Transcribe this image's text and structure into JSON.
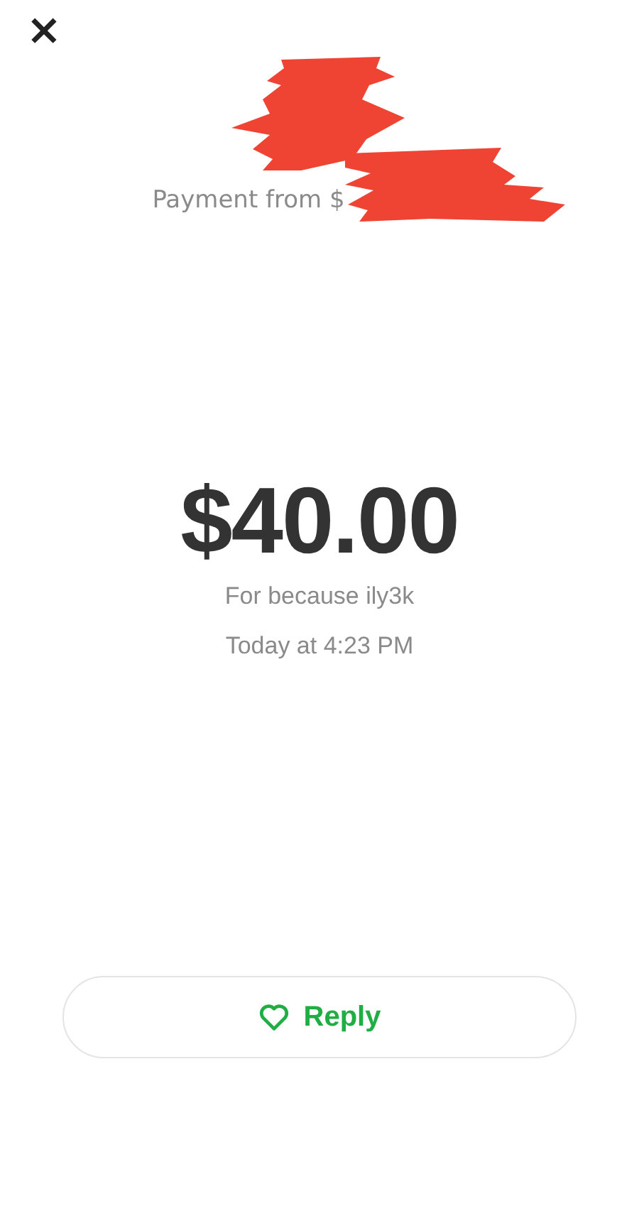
{
  "header": {
    "close": "×"
  },
  "sender": {
    "subtitle": "Payment from $"
  },
  "payment": {
    "amount": "$40.00",
    "note": "For because ily3k",
    "time": "Today at 4:23 PM"
  },
  "reply_button": {
    "label": "Reply"
  }
}
